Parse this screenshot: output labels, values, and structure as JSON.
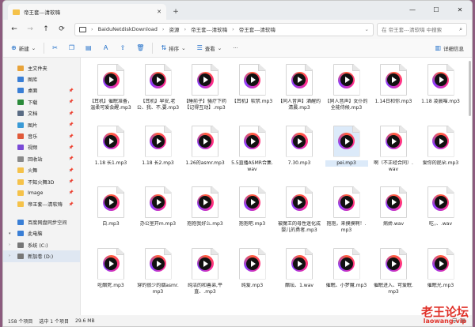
{
  "window": {
    "tab_title": "帝王套---清软嗨",
    "new_tab": "+",
    "min": "—",
    "max": "☐",
    "close": "✕",
    "tab_close": "✕"
  },
  "address": {
    "crumbs": [
      "BaiduNetdiskDownload",
      "资源",
      "帝王套---清软嗨",
      "帝王套---清软嗨"
    ],
    "search_placeholder": "在 帝王套---清软嗨 中搜索"
  },
  "toolbar": {
    "new_label": "新建",
    "sort_label": "排序",
    "view_label": "查看",
    "more_label": "···",
    "details_label": "详细信息"
  },
  "sidebar": {
    "items": [
      {
        "label": "主文件夹",
        "icon": "home-icon",
        "color": "#e8a33a"
      },
      {
        "label": "图库",
        "icon": "gallery-icon",
        "color": "#3a7fd6"
      },
      {
        "label": "桌面",
        "icon": "desktop-icon",
        "color": "#3a7fd6",
        "pin": true
      },
      {
        "label": "下载",
        "icon": "download-icon",
        "color": "#2a8a3a",
        "pin": true
      },
      {
        "label": "文档",
        "icon": "document-icon",
        "color": "#5a6c84",
        "pin": true
      },
      {
        "label": "图片",
        "icon": "picture-icon",
        "color": "#3a9ad6",
        "pin": true
      },
      {
        "label": "音乐",
        "icon": "music-icon",
        "color": "#e05a3a",
        "pin": true
      },
      {
        "label": "视频",
        "icon": "video-icon",
        "color": "#7a4ad6",
        "pin": true
      },
      {
        "label": "回收站",
        "icon": "recycle-bin-icon",
        "color": "#8a8a8a",
        "pin": true
      },
      {
        "label": "火舞",
        "icon": "folder-icon",
        "color": "#f5c24a",
        "pin": true
      },
      {
        "label": "不知火舞3D",
        "icon": "folder-icon",
        "color": "#f5c24a",
        "pin": true
      },
      {
        "label": "Image",
        "icon": "folder-icon",
        "color": "#f5c24a",
        "pin": true
      },
      {
        "label": "帝王套---清软嗨",
        "icon": "folder-icon",
        "color": "#f5c24a",
        "pin": true
      },
      {
        "label": "百度网盘同步空间",
        "icon": "cloud-icon",
        "color": "#3a7fd6",
        "gap": true
      },
      {
        "label": "此电脑",
        "icon": "pc-icon",
        "color": "#3a7fd6",
        "caret": "▾"
      },
      {
        "label": "系统 (C:)",
        "icon": "drive-icon",
        "color": "#777777",
        "caret": "›"
      },
      {
        "label": "新加卷 (D:)",
        "icon": "drive-icon",
        "color": "#777777",
        "caret": "›",
        "selected": true
      }
    ]
  },
  "files": [
    {
      "name": "【耳机】催眠准备，温柔可爱会醒.mp3"
    },
    {
      "name": "【耳机】早安,老公、我、不,要.mp3"
    },
    {
      "name": "【睡前子】骚疗下药【记得互动】.mp3"
    },
    {
      "name": "【耳机】软禁.mp3"
    },
    {
      "name": "【同人音声】酒醒的清晨.mp3"
    },
    {
      "name": "【同人音声】女仆的全能侍候.mp3"
    },
    {
      "name": "1.14日和你.mp3"
    },
    {
      "name": "1.18 凌晨喵.mp3"
    },
    {
      "name": "1.18 长1.mp3"
    },
    {
      "name": "1.18 长2.mp3"
    },
    {
      "name": "1.26的asmr.mp3"
    },
    {
      "name": "5.5直播ASMR合集.wav"
    },
    {
      "name": "7.30.mp3"
    },
    {
      "name": "pei.mp3",
      "selected": true
    },
    {
      "name": "啊（不正经合同）.wav"
    },
    {
      "name": "爱你的屁朵.mp3"
    },
    {
      "name": "白.mp3"
    },
    {
      "name": "办公室开m.mp3"
    },
    {
      "name": "抱抱我好么.mp3"
    },
    {
      "name": "抱抱吧.mp3"
    },
    {
      "name": "被魔王的母性迷化成婴儿的勇者.mp3"
    },
    {
      "name": "抱抱，来摸摸啊！.mp3"
    },
    {
      "name": "病娇.wav"
    },
    {
      "name": "吃，、.wav"
    },
    {
      "name": "吃醋死.mp3"
    },
    {
      "name": "穿的很少的烟asmr.mp3"
    },
    {
      "name": "纯洁的和善弟,平直、.mp3"
    },
    {
      "name": "纯爱.mp3"
    },
    {
      "name": "醋坛、1.wav"
    },
    {
      "name": "催眠、小梦魔.mp3"
    },
    {
      "name": "催眠进入、可爱眠.mp3"
    },
    {
      "name": "催眠光.mp3"
    }
  ],
  "status": {
    "count": "158 个项目",
    "selection": "选中 1 个项目",
    "size": "29.6 MB",
    "view_list": "☰",
    "view_grid": "▦"
  },
  "watermark": {
    "line1": "老王论坛",
    "line2": "laowang.vip"
  }
}
